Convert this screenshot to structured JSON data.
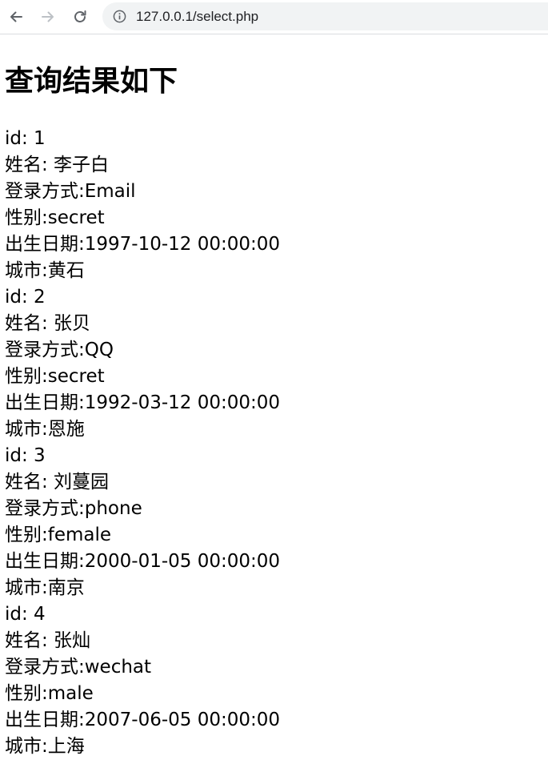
{
  "browser": {
    "url": "127.0.0.1/select.php",
    "icons": [
      "back-arrow-icon",
      "forward-arrow-icon",
      "reload-icon",
      "info-icon"
    ]
  },
  "page": {
    "heading": "查询结果如下",
    "lines": [
      "id: 1",
      "姓名: 李子白",
      "登录方式:Email",
      "性别:secret",
      "出生日期:1997-10-12 00:00:00",
      "城市:黄石",
      "id: 2",
      "姓名: 张贝",
      "登录方式:QQ",
      "性别:secret",
      "出生日期:1992-03-12 00:00:00",
      "城市:恩施",
      "id: 3",
      "姓名: 刘蔓园",
      "登录方式:phone",
      "性别:female",
      "出生日期:2000-01-05 00:00:00",
      "城市:南京",
      "id: 4",
      "姓名: 张灿",
      "登录方式:wechat",
      "性别:male",
      "出生日期:2007-06-05 00:00:00",
      "城市:上海"
    ]
  }
}
